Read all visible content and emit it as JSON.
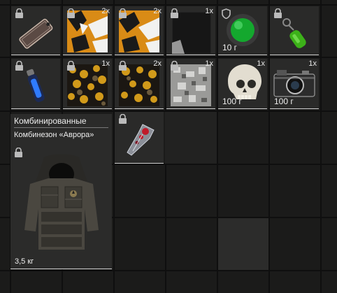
{
  "inventory": {
    "row1": [
      {
        "icon": "tag-keychain-icon",
        "locked": true,
        "count": "",
        "price": ""
      },
      {
        "icon": "camo-fabric-orange-icon",
        "locked": true,
        "count": "2x",
        "price": ""
      },
      {
        "icon": "camo-fabric-orange-icon",
        "locked": true,
        "count": "2x",
        "price": ""
      },
      {
        "icon": "dark-panel-icon",
        "locked": true,
        "count": "1x",
        "price": ""
      },
      {
        "icon": "green-orb-icon",
        "locked": false,
        "count": "",
        "price": "10 г"
      },
      {
        "icon": "green-keychain-icon",
        "locked": true,
        "count": "",
        "price": ""
      }
    ],
    "row2": [
      {
        "icon": "blue-vial-icon",
        "locked": true,
        "count": "",
        "price": ""
      },
      {
        "icon": "camo-fabric-yellow-icon",
        "locked": true,
        "count": "1x",
        "price": ""
      },
      {
        "icon": "camo-fabric-yellow-icon",
        "locked": true,
        "count": "2x",
        "price": ""
      },
      {
        "icon": "digital-camo-gray-icon",
        "locked": true,
        "count": "1x",
        "price": ""
      },
      {
        "icon": "skull-icon",
        "locked": false,
        "count": "1x",
        "price": "100 г"
      },
      {
        "icon": "camera-icon",
        "locked": false,
        "count": "1x",
        "price": "100 г"
      }
    ],
    "featured": {
      "category": "Комбинированные",
      "name": "Комбинезон «Аврора»",
      "weight": "3,5 кг",
      "icon": "armored-suit-icon",
      "locked": true
    },
    "pendant": {
      "icon": "crystal-pendant-icon",
      "locked": true
    }
  }
}
